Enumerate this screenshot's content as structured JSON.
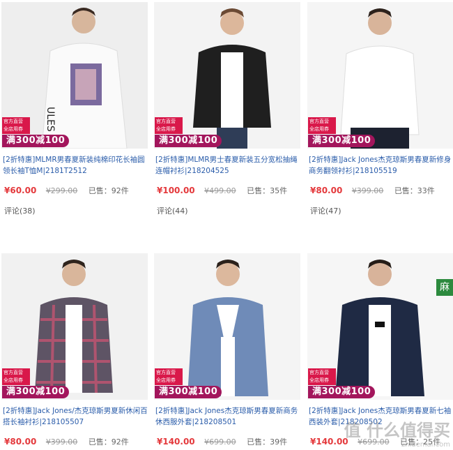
{
  "products": [
    {
      "title": "[2折特惠]MLMR男春夏新装纯棉印花长袖圆领长袖T恤M|2181T2512",
      "price": "¥60.00",
      "original_price": "¥299.00",
      "sold": "已售：92件",
      "reviews": "评论(38)",
      "badge_official": "官方直营 全店用券",
      "badge_sale": "满300减100"
    },
    {
      "title": "[2折特惠]MLMR男士春夏新装五分宽松抽绳连帽衬衫|218204525",
      "price": "¥100.00",
      "original_price": "¥499.00",
      "sold": "已售：35件",
      "reviews": "评论(44)",
      "badge_official": "官方直营 全店用券",
      "badge_sale": "满300减100"
    },
    {
      "title": "[2折特惠]Jack Jones杰克琼斯男春夏新修身商务翻领衬衫|218105519",
      "price": "¥80.00",
      "original_price": "¥399.00",
      "sold": "已售：33件",
      "reviews": "评论(47)",
      "badge_official": "官方直营 全店用券",
      "badge_sale": "满300减100"
    },
    {
      "title": "[2折特惠]Jack Jones/杰克琼斯男夏新休闲百搭长袖衬衫|218105507",
      "price": "¥80.00",
      "original_price": "¥399.00",
      "sold": "已售：92件",
      "reviews": "",
      "badge_official": "官方直营 全店用券",
      "badge_sale": "满300减100"
    },
    {
      "title": "[2折特惠]Jack Jones杰克琼斯男春夏新商务休西服外套|218208501",
      "price": "¥140.00",
      "original_price": "¥699.00",
      "sold": "已售：39件",
      "reviews": "",
      "badge_official": "官方直营 全店用券",
      "badge_sale": "满300减100"
    },
    {
      "title": "[2折特惠]Jack Jones杰克琼斯男春夏新七袖西装外套|218208502",
      "price": "¥140.00",
      "original_price": "¥699.00",
      "sold": "已售：25件",
      "reviews": "",
      "badge_official": "官方直营 全店用券",
      "badge_sale": "满300减100"
    }
  ],
  "side_tag": "麻",
  "watermark": {
    "text": "值 什么值得买",
    "sub": "zhidemai.com"
  }
}
